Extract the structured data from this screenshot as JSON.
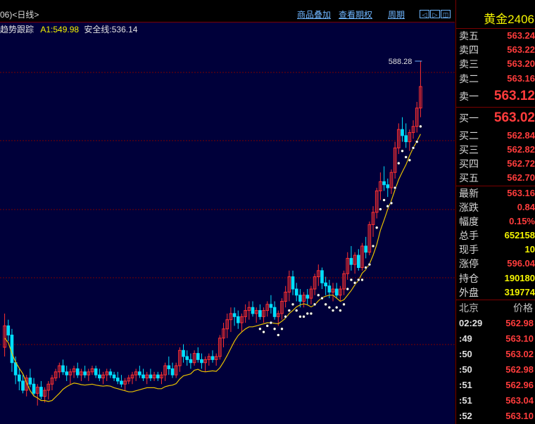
{
  "chart": {
    "title": "06)<日线>",
    "links": [
      "商品叠加",
      "查看期权",
      "周期"
    ],
    "nav_buttons": [
      "◁",
      "▷",
      "◫"
    ],
    "indicator_name": "趋势跟踪",
    "a1_text": "A1:549.98",
    "safe_line_text": "安全线:536.14",
    "peak_label": "588.28",
    "colors": {
      "bg": "#00003a",
      "up": "#ff3030",
      "down": "#00e0ff",
      "grid": "#7a0000",
      "ma": "#e8c000"
    }
  },
  "chart_data": {
    "type": "candlestick",
    "price_range": [
      470,
      594
    ],
    "peak": 588.28,
    "candles": [
      [
        495,
        506,
        492,
        502
      ],
      [
        502,
        504,
        497,
        499
      ],
      [
        499,
        501,
        487,
        490
      ],
      [
        490,
        492,
        483,
        486
      ],
      [
        486,
        488,
        481,
        484
      ],
      [
        484,
        486,
        480,
        481
      ],
      [
        481,
        486,
        479,
        485
      ],
      [
        485,
        488,
        482,
        483
      ],
      [
        483,
        485,
        479,
        480
      ],
      [
        480,
        483,
        476,
        482
      ],
      [
        482,
        484,
        478,
        479
      ],
      [
        479,
        482,
        477,
        481
      ],
      [
        481,
        484,
        478,
        483
      ],
      [
        483,
        486,
        481,
        485
      ],
      [
        485,
        488,
        484,
        487
      ],
      [
        487,
        490,
        485,
        489
      ],
      [
        489,
        491,
        486,
        487
      ],
      [
        487,
        489,
        484,
        486
      ],
      [
        486,
        488,
        483,
        487
      ],
      [
        487,
        489,
        485,
        488
      ],
      [
        488,
        490,
        485,
        486
      ],
      [
        486,
        488,
        484,
        487
      ],
      [
        487,
        489,
        485,
        486
      ],
      [
        486,
        488,
        484,
        487
      ],
      [
        487,
        489,
        486,
        488
      ],
      [
        488,
        489,
        485,
        486
      ],
      [
        486,
        488,
        484,
        485
      ],
      [
        485,
        487,
        483,
        486
      ],
      [
        486,
        488,
        484,
        487
      ],
      [
        487,
        488,
        485,
        486
      ],
      [
        486,
        487,
        484,
        485
      ],
      [
        485,
        487,
        483,
        484
      ],
      [
        484,
        486,
        482,
        483
      ],
      [
        483,
        485,
        481,
        484
      ],
      [
        484,
        486,
        483,
        485
      ],
      [
        485,
        487,
        483,
        486
      ],
      [
        486,
        488,
        484,
        487
      ],
      [
        487,
        489,
        485,
        486
      ],
      [
        486,
        488,
        484,
        485
      ],
      [
        485,
        487,
        483,
        486
      ],
      [
        486,
        488,
        484,
        485
      ],
      [
        485,
        487,
        484,
        486
      ],
      [
        486,
        487,
        484,
        485
      ],
      [
        485,
        487,
        483,
        486
      ],
      [
        486,
        490,
        484,
        489
      ],
      [
        489,
        492,
        486,
        488
      ],
      [
        488,
        490,
        485,
        486
      ],
      [
        486,
        490,
        485,
        489
      ],
      [
        489,
        495,
        487,
        494
      ],
      [
        494,
        496,
        490,
        492
      ],
      [
        492,
        494,
        489,
        491
      ],
      [
        491,
        493,
        488,
        490
      ],
      [
        490,
        494,
        489,
        493
      ],
      [
        493,
        495,
        490,
        491
      ],
      [
        491,
        493,
        488,
        490
      ],
      [
        490,
        492,
        487,
        491
      ],
      [
        491,
        493,
        489,
        492
      ],
      [
        492,
        494,
        490,
        491
      ],
      [
        491,
        493,
        489,
        492
      ],
      [
        492,
        499,
        491,
        498
      ],
      [
        498,
        503,
        495,
        501
      ],
      [
        501,
        506,
        498,
        504
      ],
      [
        504,
        508,
        500,
        506
      ],
      [
        506,
        508,
        502,
        505
      ],
      [
        505,
        507,
        501,
        503
      ],
      [
        503,
        506,
        500,
        505
      ],
      [
        505,
        509,
        503,
        507
      ],
      [
        507,
        510,
        504,
        508
      ],
      [
        508,
        510,
        505,
        506
      ],
      [
        506,
        508,
        503,
        507
      ],
      [
        507,
        509,
        504,
        505
      ],
      [
        505,
        508,
        503,
        507
      ],
      [
        507,
        510,
        505,
        509
      ],
      [
        509,
        512,
        506,
        508
      ],
      [
        508,
        510,
        504,
        505
      ],
      [
        505,
        507,
        502,
        506
      ],
      [
        506,
        511,
        504,
        510
      ],
      [
        510,
        515,
        508,
        513
      ],
      [
        513,
        520,
        510,
        518
      ],
      [
        518,
        520,
        512,
        514
      ],
      [
        514,
        516,
        510,
        512
      ],
      [
        512,
        514,
        508,
        510
      ],
      [
        510,
        513,
        508,
        512
      ],
      [
        512,
        514,
        509,
        511
      ],
      [
        511,
        515,
        509,
        514
      ],
      [
        514,
        519,
        512,
        518
      ],
      [
        518,
        522,
        515,
        520
      ],
      [
        520,
        521,
        514,
        516
      ],
      [
        516,
        518,
        512,
        515
      ],
      [
        515,
        517,
        511,
        513
      ],
      [
        513,
        516,
        510,
        514
      ],
      [
        514,
        516,
        511,
        512
      ],
      [
        512,
        515,
        510,
        514
      ],
      [
        514,
        520,
        512,
        519
      ],
      [
        519,
        526,
        517,
        524
      ],
      [
        524,
        528,
        520,
        522
      ],
      [
        522,
        526,
        519,
        525
      ],
      [
        525,
        527,
        520,
        521
      ],
      [
        521,
        529,
        520,
        528
      ],
      [
        528,
        531,
        524,
        526
      ],
      [
        526,
        536,
        525,
        535
      ],
      [
        535,
        541,
        531,
        539
      ],
      [
        539,
        547,
        537,
        546
      ],
      [
        546,
        552,
        543,
        549
      ],
      [
        549,
        554,
        546,
        548
      ],
      [
        548,
        550,
        544,
        547
      ],
      [
        547,
        553,
        545,
        552
      ],
      [
        552,
        562,
        550,
        560
      ],
      [
        560,
        568,
        558,
        566
      ],
      [
        566,
        570,
        562,
        564
      ],
      [
        564,
        568,
        560,
        562
      ],
      [
        562,
        566,
        559,
        565
      ],
      [
        565,
        569,
        563,
        567
      ],
      [
        567,
        575,
        565,
        573
      ],
      [
        573,
        588.28,
        570,
        580
      ]
    ]
  },
  "quote": {
    "instrument": "黄金2406",
    "asks": [
      {
        "label": "卖五",
        "value": "563.24"
      },
      {
        "label": "卖四",
        "value": "563.22"
      },
      {
        "label": "卖三",
        "value": "563.20"
      },
      {
        "label": "卖二",
        "value": "563.16"
      }
    ],
    "ask1": {
      "label": "卖一",
      "value": "563.12"
    },
    "bid1": {
      "label": "买一",
      "value": "563.02"
    },
    "bids": [
      {
        "label": "买二",
        "value": "562.84"
      },
      {
        "label": "买三",
        "value": "562.82"
      },
      {
        "label": "买四",
        "value": "562.72"
      },
      {
        "label": "买五",
        "value": "562.70"
      }
    ],
    "stats": [
      {
        "label": "最新",
        "value": "563.16",
        "color": "red"
      },
      {
        "label": "涨跌",
        "value": "0.84",
        "color": "red"
      },
      {
        "label": "幅度",
        "value": "0.15%",
        "color": "red"
      },
      {
        "label": "总手",
        "value": "652158",
        "color": "yellow"
      },
      {
        "label": "现手",
        "value": "10",
        "color": "yellow"
      },
      {
        "label": "涨停",
        "value": "596.04",
        "color": "red"
      },
      {
        "label": "持仓",
        "value": "190180",
        "color": "yellow"
      },
      {
        "label": "外盘",
        "value": "319774",
        "color": "yellow"
      }
    ],
    "ticks_header": {
      "left": "北京",
      "right": "价格"
    },
    "ticks": [
      {
        "time": "02:29",
        "price": "562.98"
      },
      {
        "time": ":49",
        "price": "563.10"
      },
      {
        "time": ":50",
        "price": "563.02"
      },
      {
        "time": ":50",
        "price": "562.98"
      },
      {
        "time": ":51",
        "price": "562.96"
      },
      {
        "time": ":51",
        "price": "563.04"
      },
      {
        "time": ":52",
        "price": "563.10"
      }
    ]
  }
}
